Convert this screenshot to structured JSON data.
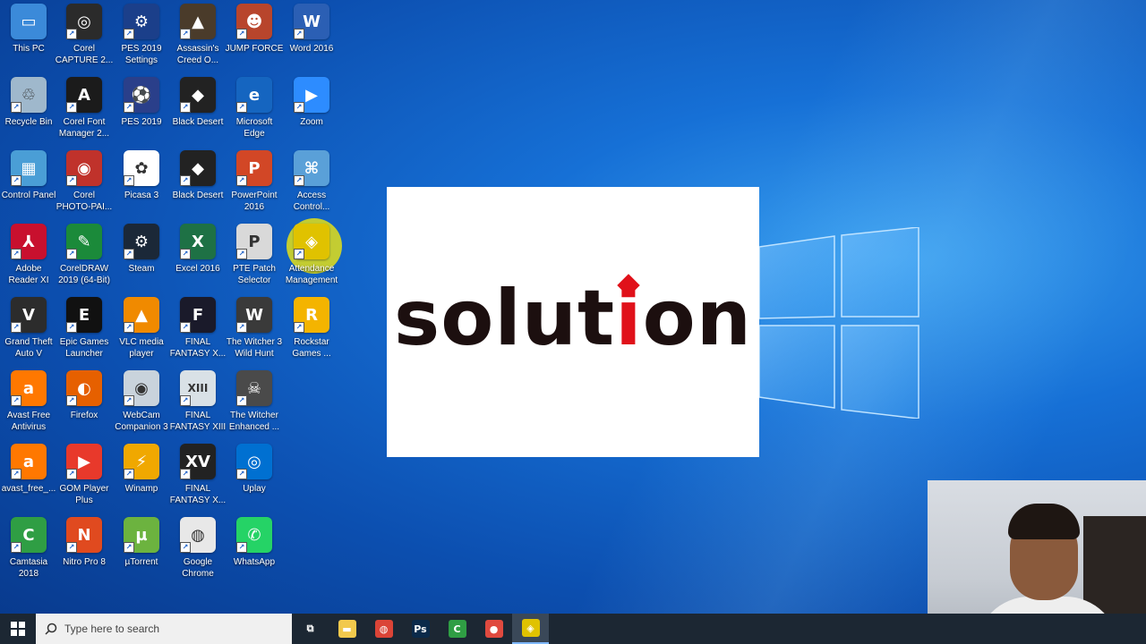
{
  "desktop_icons": [
    {
      "label": "This PC",
      "icon": "computer-icon",
      "color": "#3b8ad9",
      "glyph": "▭",
      "col": 0,
      "row": 0
    },
    {
      "label": "Corel\nCAPTURE 2...",
      "icon": "corel-capture-icon",
      "color": "#2b2b2b",
      "glyph": "◎",
      "col": 1,
      "row": 0
    },
    {
      "label": "PES 2019\nSettings",
      "icon": "pes-settings-icon",
      "color": "#1b3f8a",
      "glyph": "⚙",
      "col": 2,
      "row": 0
    },
    {
      "label": "Assassin's\nCreed O...",
      "icon": "assassins-creed-icon",
      "color": "#4a3b2a",
      "glyph": "▲",
      "col": 3,
      "row": 0
    },
    {
      "label": "JUMP FORCE",
      "icon": "jump-force-icon",
      "color": "#b8452c",
      "glyph": "☻",
      "col": 4,
      "row": 0
    },
    {
      "label": "Word 2016",
      "icon": "word-icon",
      "color": "#2b5fb4",
      "glyph": "W",
      "col": 5,
      "row": 0
    },
    {
      "label": "Recycle Bin",
      "icon": "recycle-bin-icon",
      "color": "#9fb8cc",
      "glyph": "♲",
      "col": 0,
      "row": 1
    },
    {
      "label": "Corel Font\nManager 2...",
      "icon": "corel-font-icon",
      "color": "#1b1b1b",
      "glyph": "A",
      "col": 1,
      "row": 1
    },
    {
      "label": "PES 2019",
      "icon": "pes-icon",
      "color": "#2a3f8a",
      "glyph": "⚽",
      "col": 2,
      "row": 1
    },
    {
      "label": "Black Desert",
      "icon": "black-desert-icon",
      "color": "#222222",
      "glyph": "◆",
      "col": 3,
      "row": 1
    },
    {
      "label": "Microsoft\nEdge",
      "icon": "edge-icon",
      "color": "#1565c0",
      "glyph": "e",
      "col": 4,
      "row": 1
    },
    {
      "label": "Zoom",
      "icon": "zoom-icon",
      "color": "#2d8cff",
      "glyph": "▶",
      "col": 5,
      "row": 1
    },
    {
      "label": "Control Panel",
      "icon": "control-panel-icon",
      "color": "#4a9ed6",
      "glyph": "▦",
      "col": 0,
      "row": 2
    },
    {
      "label": "Corel\nPHOTO-PAI...",
      "icon": "corel-photopaint-icon",
      "color": "#c0322b",
      "glyph": "◉",
      "col": 1,
      "row": 2
    },
    {
      "label": "Picasa 3",
      "icon": "picasa-icon",
      "color": "#ffffff",
      "glyph": "✿",
      "col": 2,
      "row": 2
    },
    {
      "label": "Black Desert",
      "icon": "black-desert-icon",
      "color": "#222222",
      "glyph": "◆",
      "col": 3,
      "row": 2
    },
    {
      "label": "PowerPoint\n2016",
      "icon": "powerpoint-icon",
      "color": "#d24726",
      "glyph": "P",
      "col": 4,
      "row": 2
    },
    {
      "label": "Access\nControl...",
      "icon": "access-control-icon",
      "color": "#5aa0d8",
      "glyph": "⌘",
      "col": 5,
      "row": 2
    },
    {
      "label": "Adobe\nReader XI",
      "icon": "adobe-reader-icon",
      "color": "#c8102e",
      "glyph": "⅄",
      "col": 0,
      "row": 3
    },
    {
      "label": "CorelDRAW\n2019 (64-Bit)",
      "icon": "coreldraw-icon",
      "color": "#1b8a3a",
      "glyph": "✎",
      "col": 1,
      "row": 3
    },
    {
      "label": "Steam",
      "icon": "steam-icon",
      "color": "#1b2838",
      "glyph": "⚙",
      "col": 2,
      "row": 3
    },
    {
      "label": "Excel 2016",
      "icon": "excel-icon",
      "color": "#1e7145",
      "glyph": "X",
      "col": 3,
      "row": 3
    },
    {
      "label": "PTE Patch\nSelector",
      "icon": "pte-patch-icon",
      "color": "#d9d9d9",
      "glyph": "P",
      "col": 4,
      "row": 3
    },
    {
      "label": "Attendance\nManagement",
      "icon": "attendance-icon",
      "color": "#e0c200",
      "glyph": "◈",
      "col": 5,
      "row": 3
    },
    {
      "label": "Grand Theft\nAuto V",
      "icon": "gta-icon",
      "color": "#2c2c2c",
      "glyph": "V",
      "col": 0,
      "row": 4
    },
    {
      "label": "Epic Games\nLauncher",
      "icon": "epic-games-icon",
      "color": "#111111",
      "glyph": "E",
      "col": 1,
      "row": 4
    },
    {
      "label": "VLC media\nplayer",
      "icon": "vlc-icon",
      "color": "#f08a00",
      "glyph": "▲",
      "col": 2,
      "row": 4
    },
    {
      "label": "FINAL\nFANTASY X...",
      "icon": "final-fantasy-icon",
      "color": "#1a1a2a",
      "glyph": "F",
      "col": 3,
      "row": 4
    },
    {
      "label": "The Witcher 3\nWild Hunt",
      "icon": "witcher-icon",
      "color": "#3a3a3a",
      "glyph": "W",
      "col": 4,
      "row": 4
    },
    {
      "label": "Rockstar\nGames ...",
      "icon": "rockstar-icon",
      "color": "#f4b400",
      "glyph": "R",
      "col": 5,
      "row": 4
    },
    {
      "label": "Avast Free\nAntivirus",
      "icon": "avast-icon",
      "color": "#ff7800",
      "glyph": "a",
      "col": 0,
      "row": 5
    },
    {
      "label": "Firefox",
      "icon": "firefox-icon",
      "color": "#e66000",
      "glyph": "◐",
      "col": 1,
      "row": 5
    },
    {
      "label": "WebCam\nCompanion 3",
      "icon": "webcam-icon",
      "color": "#c9d3dc",
      "glyph": "◉",
      "col": 2,
      "row": 5
    },
    {
      "label": "FINAL\nFANTASY XIII",
      "icon": "final-fantasy-13-icon",
      "color": "#d9e1e6",
      "glyph": "XIII",
      "col": 3,
      "row": 5
    },
    {
      "label": "The Witcher\nEnhanced ...",
      "icon": "witcher-enhanced-icon",
      "color": "#4a4a4a",
      "glyph": "☠",
      "col": 4,
      "row": 5
    },
    {
      "label": "avast_free_...",
      "icon": "avast-installer-icon",
      "color": "#ff7800",
      "glyph": "a",
      "col": 0,
      "row": 6
    },
    {
      "label": "GOM Player\nPlus",
      "icon": "gom-player-icon",
      "color": "#e8392b",
      "glyph": "▶",
      "col": 1,
      "row": 6
    },
    {
      "label": "Winamp",
      "icon": "winamp-icon",
      "color": "#f0a800",
      "glyph": "⚡",
      "col": 2,
      "row": 6
    },
    {
      "label": "FINAL\nFANTASY X...",
      "icon": "final-fantasy-xv-icon",
      "color": "#222222",
      "glyph": "XV",
      "col": 3,
      "row": 6
    },
    {
      "label": "Uplay",
      "icon": "uplay-icon",
      "color": "#0070d1",
      "glyph": "◎",
      "col": 4,
      "row": 6
    },
    {
      "label": "Camtasia\n2018",
      "icon": "camtasia-icon",
      "color": "#2f9e44",
      "glyph": "C",
      "col": 0,
      "row": 7
    },
    {
      "label": "Nitro Pro 8",
      "icon": "nitro-icon",
      "color": "#e04a1f",
      "glyph": "N",
      "col": 1,
      "row": 7
    },
    {
      "label": "µTorrent",
      "icon": "utorrent-icon",
      "color": "#6cb33f",
      "glyph": "µ",
      "col": 2,
      "row": 7
    },
    {
      "label": "Google\nChrome",
      "icon": "chrome-icon",
      "color": "#e8e8e8",
      "glyph": "◍",
      "col": 3,
      "row": 7
    },
    {
      "label": "WhatsApp",
      "icon": "whatsapp-icon",
      "color": "#25d366",
      "glyph": "✆",
      "col": 4,
      "row": 7
    }
  ],
  "overlay": {
    "word_start": "solut",
    "word_accent": "i",
    "word_end": "on",
    "accent_color": "#e0111a",
    "text_color": "#1c0f0f"
  },
  "taskbar": {
    "search_placeholder": "Type here to search",
    "apps": [
      {
        "name": "task-view-icon",
        "glyph": "⧉",
        "color": "#1c2733",
        "active": false
      },
      {
        "name": "file-explorer-icon",
        "glyph": "▬",
        "color": "#f2c94c",
        "active": false
      },
      {
        "name": "chrome-icon",
        "glyph": "◍",
        "color": "#db4437",
        "active": false
      },
      {
        "name": "photoshop-icon",
        "glyph": "Ps",
        "color": "#0b2a4a",
        "active": false
      },
      {
        "name": "camtasia-icon",
        "glyph": "C",
        "color": "#2f9e44",
        "active": false
      },
      {
        "name": "camtasia-recorder-icon",
        "glyph": "●",
        "color": "#e04a3f",
        "active": false
      },
      {
        "name": "attendance-icon",
        "glyph": "◈",
        "color": "#e0c200",
        "active": true
      }
    ]
  }
}
